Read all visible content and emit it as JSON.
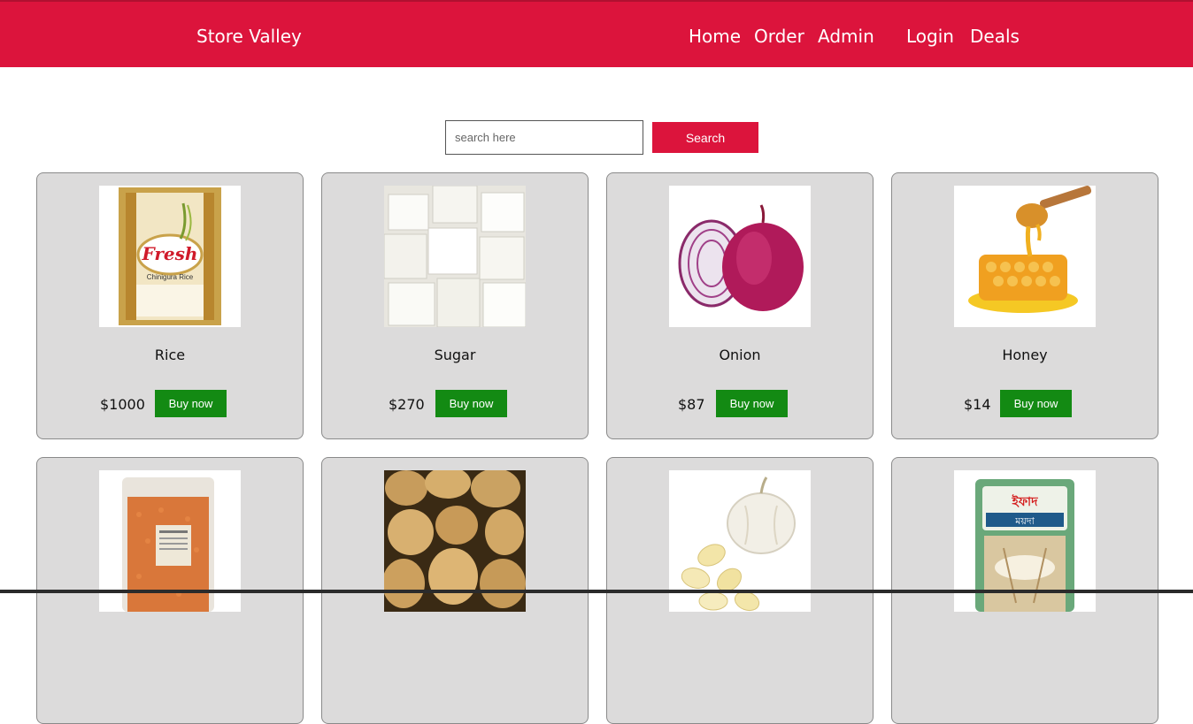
{
  "header": {
    "brand": "Store Valley",
    "nav": [
      "Home",
      "Order",
      "Admin",
      "Login",
      "Deals"
    ]
  },
  "search": {
    "placeholder": "search here",
    "button": "Search"
  },
  "products": [
    {
      "name": "Rice",
      "price": "$1000",
      "buy_label": "Buy now",
      "image": "rice-bag"
    },
    {
      "name": "Sugar",
      "price": "$270",
      "buy_label": "Buy now",
      "image": "sugar-cubes"
    },
    {
      "name": "Onion",
      "price": "$87",
      "buy_label": "Buy now",
      "image": "red-onion"
    },
    {
      "name": "Honey",
      "price": "$14",
      "buy_label": "Buy now",
      "image": "honeycomb"
    },
    {
      "name": "",
      "price": "",
      "buy_label": "",
      "image": "lentil-bag"
    },
    {
      "name": "",
      "price": "",
      "buy_label": "",
      "image": "potatoes"
    },
    {
      "name": "",
      "price": "",
      "buy_label": "",
      "image": "garlic"
    },
    {
      "name": "",
      "price": "",
      "buy_label": "",
      "image": "flour-bag"
    }
  ],
  "image_text": {
    "rice_brand": "Fresh",
    "rice_sub": "Chinigura Rice",
    "flour_brand": "ইফাদ",
    "flour_sub": "ময়দা"
  },
  "colors": {
    "accent": "#dc143c",
    "buy_button": "#138a13",
    "card_bg": "#dcdbdb"
  }
}
